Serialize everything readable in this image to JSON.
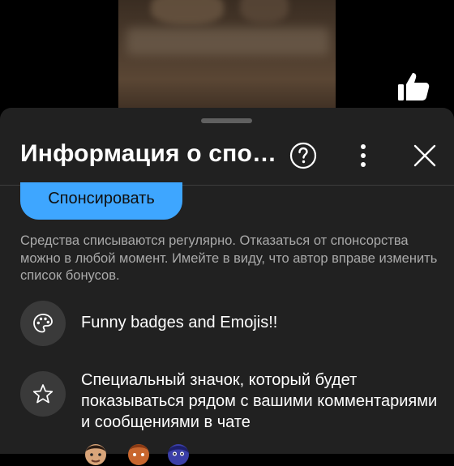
{
  "video": {
    "like_icon": "thumbs-up-icon"
  },
  "sheet": {
    "title": "Информация о спо…",
    "help_icon": "help-circle-icon",
    "more_icon": "more-vertical-icon",
    "close_icon": "close-icon",
    "sponsor_button_label": "Спонсировать",
    "info_text": "Средства списываются регулярно. Отказаться от спонсорства можно в любой момент. Имейте в виду, что автор вправе изменить список бонусов."
  },
  "benefits": [
    {
      "icon": "palette-icon",
      "label": "Funny badges and Emojis!!"
    },
    {
      "icon": "star-icon",
      "label": "Специальный значок, который будет показываться рядом с вашими комментариями и сообщениями в чате"
    }
  ],
  "emoji_previews": [
    "emoji-man-face",
    "emoji-orange-face",
    "emoji-blue-face"
  ],
  "colors": {
    "accent": "#3ea6ff",
    "sheet_background": "#212121",
    "secondary_text": "#aaaaaa"
  }
}
